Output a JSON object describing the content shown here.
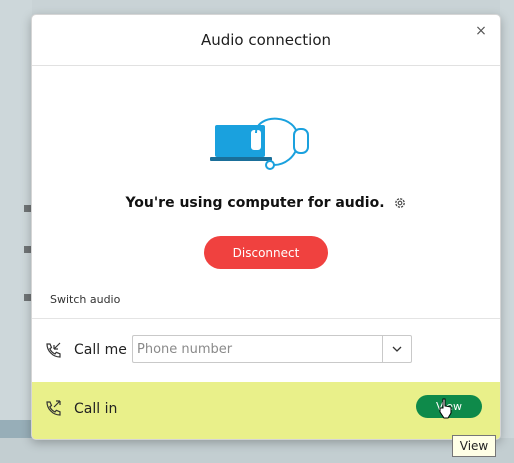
{
  "dialog": {
    "title": "Audio connection",
    "close_glyph": "×",
    "status_text": "You're using computer for audio.",
    "disconnect_label": "Disconnect",
    "switch_audio_label": "Switch audio"
  },
  "call_me": {
    "label": "Call me",
    "phone_placeholder": "Phone number",
    "phone_value": ""
  },
  "call_in": {
    "label": "Call in",
    "view_label": "View"
  },
  "tooltip": {
    "text": "View"
  },
  "colors": {
    "disconnect": "#f0413f",
    "view_button": "#0e8a4a",
    "highlight": "#e9f08a",
    "illustration_blue": "#1aa1de"
  },
  "icons": {
    "settings": "gear-icon",
    "call_me": "phone-incoming-icon",
    "call_in": "phone-outgoing-icon",
    "dropdown": "chevron-down-icon",
    "close": "close-icon"
  }
}
